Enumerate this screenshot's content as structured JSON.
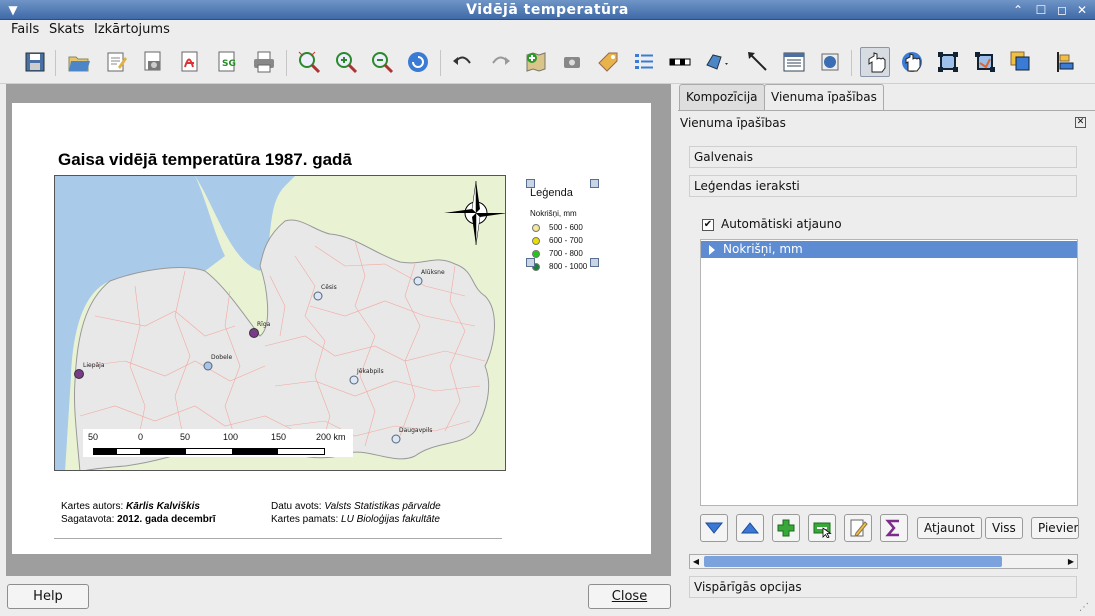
{
  "window": {
    "title": "Vidējā temperatūra"
  },
  "menu": [
    "Fails",
    "Skats",
    "Izkārtojums"
  ],
  "toolbar": {
    "icons": [
      "save-icon",
      "open-template-icon",
      "save-template-icon",
      "export-image-icon",
      "export-pdf-icon",
      "export-svg-icon",
      "print-icon",
      "zoom-full-icon",
      "zoom-in-icon",
      "zoom-out-icon",
      "refresh-icon",
      "undo-icon",
      "redo-icon",
      "add-map-icon",
      "add-image-icon",
      "add-label-icon",
      "add-legend-icon",
      "add-scalebar-icon",
      "add-shape-icon",
      "add-arrow-icon",
      "add-table-icon",
      "add-html-icon",
      "select-move-icon",
      "move-content-icon",
      "group-icon",
      "ungroup-icon",
      "raise-icon",
      "align-icon"
    ]
  },
  "composition": {
    "title": "Gaisa vidējā temperatūra 1987. gadā",
    "cities": [
      {
        "name": "Alūksne"
      },
      {
        "name": "Cēsis"
      },
      {
        "name": "Rīga"
      },
      {
        "name": "Dobele"
      },
      {
        "name": "Liepāja"
      },
      {
        "name": "Jēkabpils"
      },
      {
        "name": "Daugavpils"
      }
    ],
    "scalebar": {
      "labels": [
        "50",
        "0",
        "50",
        "100",
        "150",
        "200 km"
      ]
    },
    "legend": {
      "title": "Leģenda",
      "subtitle": "Nokrišņi, mm",
      "items": [
        {
          "label": "500 - 600",
          "color": "#f3e79a"
        },
        {
          "label": "600 - 700",
          "color": "#ecdf00"
        },
        {
          "label": "700 - 800",
          "color": "#27c41d"
        },
        {
          "label": "800 - 1000",
          "color": "#15803a"
        }
      ],
      "city_colors": {
        "purple": "#7a3a8a",
        "blue": "#a9c4e6"
      }
    },
    "credits": {
      "author_label": "Kartes autors:",
      "author": "Kārlis Kalviškis",
      "prepared_label": "Sagatavota:",
      "prepared": "2012. gada decembrī",
      "source_label": "Datu avots:",
      "source": "Valsts Statistikas pārvalde",
      "basis_label": "Kartes pamats:",
      "basis": "LU Bioloģijas fakultāte"
    }
  },
  "panel": {
    "tabs": [
      "Kompozīcija",
      "Vienuma īpašības"
    ],
    "active_tab": 1,
    "dock_title": "Vienuma īpašības",
    "groups": [
      "Galvenais",
      "Leģendas ieraksti"
    ],
    "auto_update": "Automātiski atjaunot",
    "tree_item": "Nokrišņi, mm",
    "buttons": [
      "Atjaunot",
      "Viss",
      "Pievienot"
    ],
    "general_options": "Vispārīgās opcijas"
  },
  "footer": {
    "help": "Help",
    "close": "Close"
  }
}
